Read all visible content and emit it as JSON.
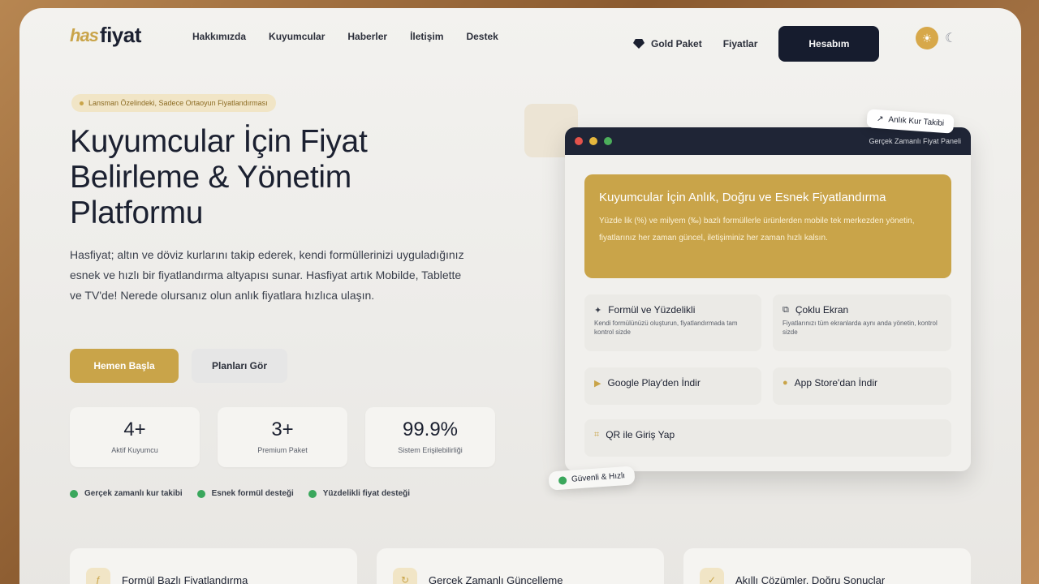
{
  "brand": {
    "mark": "has",
    "name": "fiyat"
  },
  "nav": {
    "links": [
      "Hakkımızda",
      "Kuyumcular",
      "Haberler",
      "İletişim",
      "Destek"
    ],
    "gold_paket": "Gold Paket",
    "fiyatlar": "Fiyatlar",
    "login": "Hesabım"
  },
  "hero": {
    "pill": "Lansman Özelindeki, Sadece Ortaoyun Fiyatlandırması",
    "title": "Kuyumcular İçin Fiyat Belirleme & Yönetim Platformu",
    "desc": "Hasfiyat; altın ve döviz kurlarını takip ederek, kendi formüllerinizi uyguladığınız esnek ve hızlı bir fiyatlandırma altyapısı sunar. Hasfiyat artık Mobilde, Tablette ve TV'de! Nerede olursanız olun anlık fiyatlara hızlıca ulaşın.",
    "cta_primary": "Hemen Başla",
    "cta_secondary": "Planları Gör",
    "stats": [
      {
        "value": "4+",
        "label": "Aktif Kuyumcu"
      },
      {
        "value": "3+",
        "label": "Premium Paket"
      },
      {
        "value": "99.9%",
        "label": "Sistem Erişilebilirliği"
      }
    ],
    "features": [
      "Gerçek zamanlı kur takibi",
      "Esnek formül desteği",
      "Yüzdelikli fiyat desteği"
    ]
  },
  "mock": {
    "bar_title": "Gerçek Zamanlı Fiyat Paneli",
    "float_tag": "Anlık Kur Takibi",
    "secure_tag": "Güvenli & Hızlı",
    "gold_title": "Kuyumcular İçin Anlık, Doğru ve Esnek Fiyatlandırma",
    "gold_desc": "Yüzde lik (%) ve milyem (‰) bazlı formüllerle ürünlerden mobile tek merkezden yönetin, fiyatlarınız her zaman güncel, iletişiminiz her zaman hızlı kalsın.",
    "cards": [
      {
        "title": "Formül ve Yüzdelikli",
        "desc": "Kendi formülünüzü oluşturun, fiyatlandırmada tam kontrol sizde"
      },
      {
        "title": "Çoklu Ekran",
        "desc": "Fiyatlarınızı tüm ekranlarda aynı anda yönetin, kontrol sizde"
      },
      {
        "title": "Google Play'den İndir"
      },
      {
        "title": "App Store'dan İndir"
      },
      {
        "title": "QR ile Giriş Yap"
      }
    ]
  },
  "bottom_cards": [
    "Formül Bazlı Fiyatlandırma",
    "Gerçek Zamanlı Güncelleme",
    "Akıllı Çözümler, Doğru Sonuçlar"
  ],
  "colors": {
    "gold": "#c9a449",
    "navy": "#161c2e",
    "green": "#3aa75c"
  }
}
